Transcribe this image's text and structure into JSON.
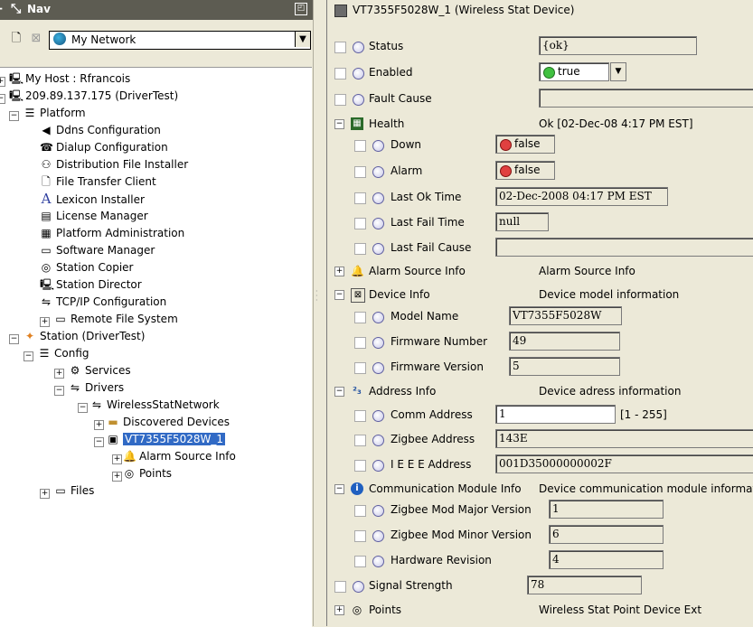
{
  "nav": {
    "title": "Nav",
    "network_select": "My Network",
    "tree": [
      {
        "label": "My Host : Rfrancois"
      },
      {
        "label": "209.89.137.175 (DriverTest)"
      },
      {
        "label": "Platform"
      },
      {
        "label": "Ddns Configuration"
      },
      {
        "label": "Dialup Configuration"
      },
      {
        "label": "Distribution File Installer"
      },
      {
        "label": "File Transfer Client"
      },
      {
        "label": "Lexicon Installer"
      },
      {
        "label": "License Manager"
      },
      {
        "label": "Platform Administration"
      },
      {
        "label": "Software Manager"
      },
      {
        "label": "Station Copier"
      },
      {
        "label": "Station Director"
      },
      {
        "label": "TCP/IP Configuration"
      },
      {
        "label": "Remote File System"
      },
      {
        "label": "Station (DriverTest)"
      },
      {
        "label": "Config"
      },
      {
        "label": "Services"
      },
      {
        "label": "Drivers"
      },
      {
        "label": "WirelessStatNetwork"
      },
      {
        "label": "Discovered Devices"
      },
      {
        "label": "VT7355F5028W_1"
      },
      {
        "label": "Alarm Source Info"
      },
      {
        "label": "Points"
      },
      {
        "label": "Files"
      }
    ]
  },
  "device": {
    "title": "VT7355F5028W_1  (Wireless Stat Device)",
    "rows": {
      "status": {
        "label": "Status",
        "value": "{ok}"
      },
      "enabled": {
        "label": "Enabled",
        "value": "true"
      },
      "fault_cause": {
        "label": "Fault Cause",
        "value": ""
      },
      "health": {
        "label": "Health",
        "value": "Ok [02-Dec-08 4:17 PM EST]"
      },
      "down": {
        "label": "Down",
        "value": "false"
      },
      "alarm": {
        "label": "Alarm",
        "value": "false"
      },
      "last_ok_time": {
        "label": "Last Ok Time",
        "value": "02-Dec-2008 04:17 PM EST"
      },
      "last_fail_time": {
        "label": "Last Fail Time",
        "value": "null"
      },
      "last_fail_cause": {
        "label": "Last Fail Cause",
        "value": ""
      },
      "alarm_source_info": {
        "label": "Alarm Source Info",
        "value": "Alarm Source Info"
      },
      "device_info": {
        "label": "Device Info",
        "value": "Device model information"
      },
      "model_name": {
        "label": "Model Name",
        "value": "VT7355F5028W"
      },
      "firmware_number": {
        "label": "Firmware Number",
        "value": "49"
      },
      "firmware_version": {
        "label": "Firmware Version",
        "value": "5"
      },
      "address_info": {
        "label": "Address Info",
        "value": "Device adress information"
      },
      "comm_address": {
        "label": "Comm Address",
        "value": "1",
        "range": "[1 - 255]"
      },
      "zigbee_address": {
        "label": "Zigbee Address",
        "value": "143E"
      },
      "ieee_address": {
        "label": "I E E E Address",
        "value": "001D35000000002F"
      },
      "comm_module_info": {
        "label": "Communication Module Info",
        "value": "Device communication module information"
      },
      "zigbee_major": {
        "label": "Zigbee Mod Major Version",
        "value": "1"
      },
      "zigbee_minor": {
        "label": "Zigbee Mod Minor Version",
        "value": "6"
      },
      "hardware_revision": {
        "label": "Hardware Revision",
        "value": "4"
      },
      "signal_strength": {
        "label": "Signal Strength",
        "value": "78"
      },
      "points": {
        "label": "Points",
        "value": "Wireless Stat Point Device Ext"
      }
    }
  },
  "colors": {
    "title_bar": "#5d5c52",
    "selection": "#316ac5",
    "true_dot": "#40c040",
    "false_dot": "#e04040"
  }
}
